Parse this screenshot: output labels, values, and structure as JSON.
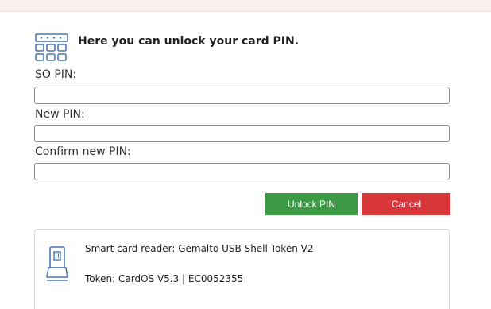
{
  "header": {
    "title": "Here you can unlock your card PIN.",
    "icon": "keypad-icon"
  },
  "fields": {
    "so_pin": {
      "label": "SO PIN:",
      "value": "",
      "placeholder": ""
    },
    "new_pin": {
      "label": "New PIN:",
      "value": "",
      "placeholder": ""
    },
    "confirm_pin": {
      "label": "Confirm new PIN:",
      "value": "",
      "placeholder": ""
    }
  },
  "buttons": {
    "unlock_label": "Unlock PIN",
    "cancel_label": "Cancel"
  },
  "info": {
    "icon": "card-reader-icon",
    "reader": "Smart card reader: Gemalto USB Shell Token V2",
    "token": "Token: CardOS V5.3 | EC0052355"
  },
  "colors": {
    "unlock": "#3c9a45",
    "cancel": "#d9363a",
    "icon_blue": "#4a77b4"
  }
}
